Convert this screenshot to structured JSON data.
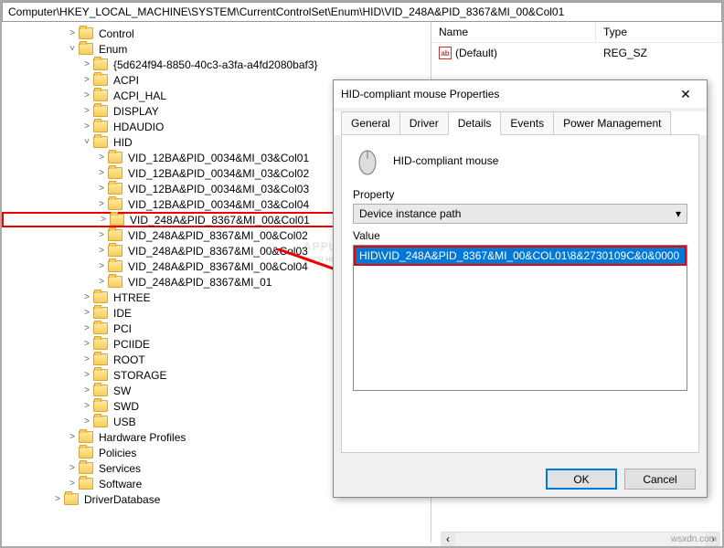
{
  "address": "Computer\\HKEY_LOCAL_MACHINE\\SYSTEM\\CurrentControlSet\\Enum\\HID\\VID_248A&PID_8367&MI_00&Col01",
  "tree": {
    "control": "Control",
    "enum": "Enum",
    "guid": "{5d624f94-8850-40c3-a3fa-a4fd2080baf3}",
    "acpi": "ACPI",
    "acpi_hal": "ACPI_HAL",
    "display": "DISPLAY",
    "hdaudio": "HDAUDIO",
    "hid": "HID",
    "h1": "VID_12BA&PID_0034&MI_03&Col01",
    "h2": "VID_12BA&PID_0034&MI_03&Col02",
    "h3": "VID_12BA&PID_0034&MI_03&Col03",
    "h4": "VID_12BA&PID_0034&MI_03&Col04",
    "h5": "VID_248A&PID_8367&MI_00&Col01",
    "h6": "VID_248A&PID_8367&MI_00&Col02",
    "h7": "VID_248A&PID_8367&MI_00&Col03",
    "h8": "VID_248A&PID_8367&MI_00&Col04",
    "h9": "VID_248A&PID_8367&MI_01",
    "htree": "HTREE",
    "ide": "IDE",
    "pci": "PCI",
    "pciide": "PCIIDE",
    "root": "ROOT",
    "storage": "STORAGE",
    "sw": "SW",
    "swd": "SWD",
    "usb": "USB",
    "hwp": "Hardware Profiles",
    "policies": "Policies",
    "services": "Services",
    "software": "Software",
    "drvdb": "DriverDatabase"
  },
  "list": {
    "col_name": "Name",
    "col_type": "Type",
    "default_name": "(Default)",
    "default_type": "REG_SZ"
  },
  "dialog": {
    "title": "HID-compliant mouse Properties",
    "tabs": {
      "general": "General",
      "driver": "Driver",
      "details": "Details",
      "events": "Events",
      "power": "Power Management"
    },
    "device": "HID-compliant mouse",
    "property_label": "Property",
    "property_value": "Device instance path",
    "value_label": "Value",
    "value": "HID\\VID_248A&PID_8367&MI_00&COL01\\8&2730109C&0&0000",
    "ok": "OK",
    "cancel": "Cancel"
  },
  "watermark": {
    "brand": "APPUALS",
    "tag": "TECH HOW-TO'S FROM THE EXPERTS"
  },
  "footer": "wsxdn.com"
}
